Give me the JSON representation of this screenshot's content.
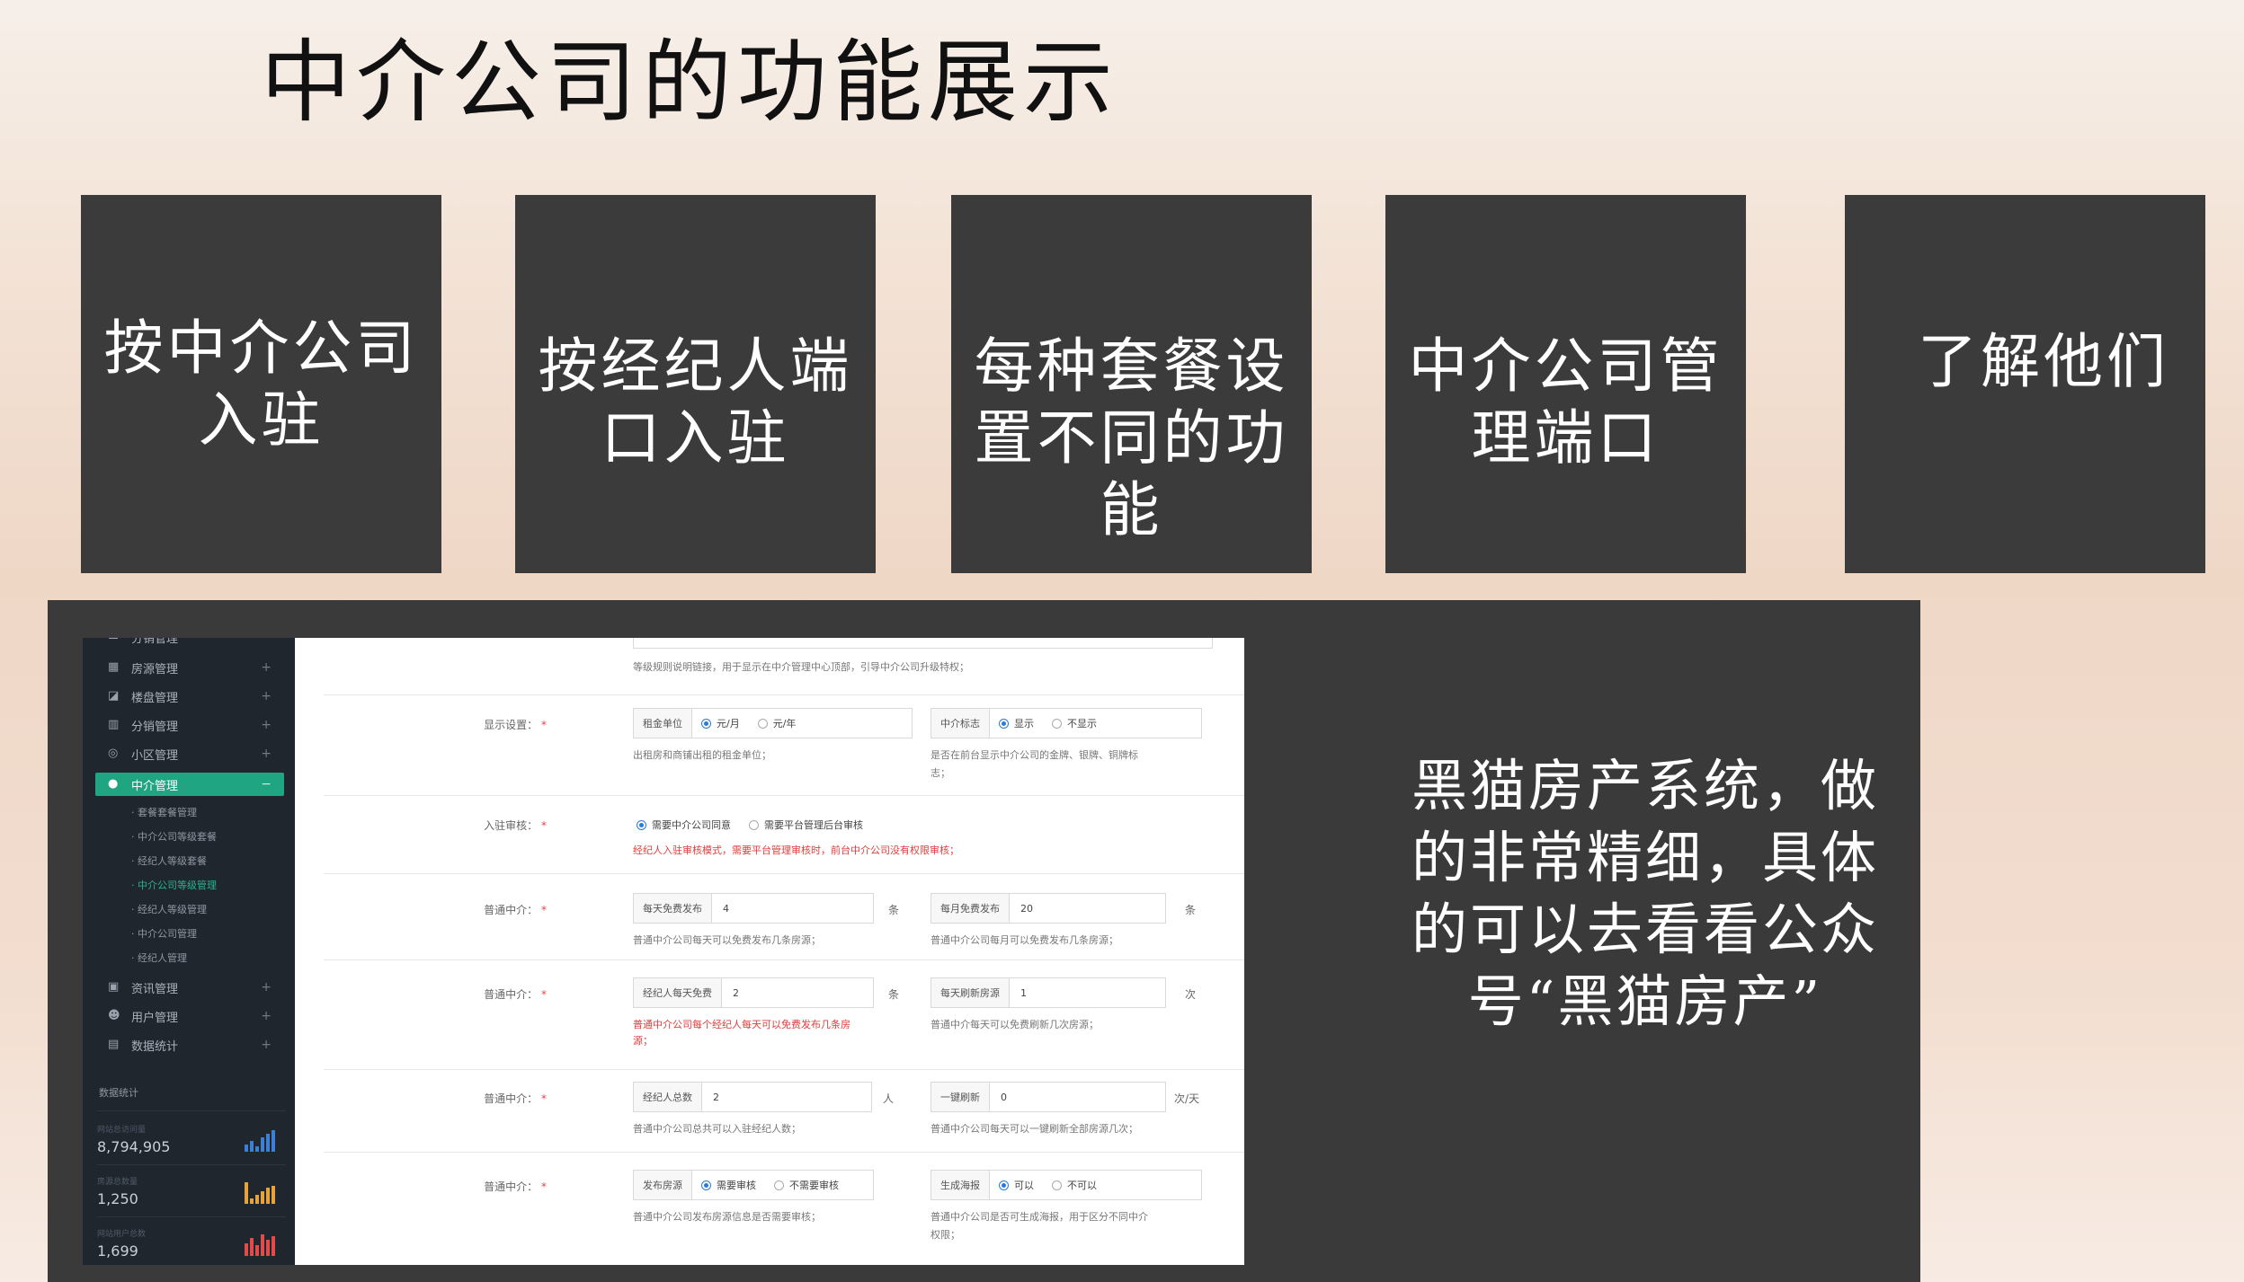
{
  "slide": {
    "title": "中介公司的功能展示",
    "cards": [
      {
        "lines": [
          "按中介公司",
          "入驻"
        ]
      },
      {
        "lines": [
          "按经纪人端",
          "口入驻"
        ]
      },
      {
        "lines": [
          "每种套餐设",
          "置不同的功",
          "能"
        ]
      },
      {
        "lines": [
          "中介公司管",
          "理端口"
        ]
      },
      {
        "lines": [
          "了解他们"
        ]
      }
    ],
    "note": "黑猫房产系统，做的非常精细，具体的可以去看看公众号“黑猫房产”"
  },
  "sidebar": {
    "top_cut": "分销管理",
    "items": [
      {
        "label": "房源管理",
        "icon": "grid-icon"
      },
      {
        "label": "楼盘管理",
        "icon": "building-icon"
      },
      {
        "label": "分销管理",
        "icon": "bank-icon"
      },
      {
        "label": "小区管理",
        "icon": "target-icon"
      },
      {
        "label": "中介管理",
        "icon": "globe-icon",
        "active": true
      }
    ],
    "subitems": [
      {
        "label": "· 套餐套餐管理"
      },
      {
        "label": "· 中介公司等级套餐"
      },
      {
        "label": "· 经纪人等级套餐"
      },
      {
        "label": "· 中介公司等级管理",
        "active": true
      },
      {
        "label": "· 经纪人等级管理"
      },
      {
        "label": "· 中介公司管理"
      },
      {
        "label": "· 经纪人管理"
      }
    ],
    "lower_items": [
      {
        "label": "资讯管理",
        "icon": "image-icon"
      },
      {
        "label": "用户管理",
        "icon": "user-icon"
      },
      {
        "label": "数据统计",
        "icon": "chart-icon"
      }
    ],
    "stats_heading": "数据统计",
    "stats": [
      {
        "label": "网站总访问量",
        "value": "8,794,905",
        "color": "#3e7fd6"
      },
      {
        "label": "房源总数量",
        "value": "1,250",
        "color": "#e6a33a"
      },
      {
        "label": "网站用户总数",
        "value": "1,699",
        "color": "#e34a4a"
      }
    ]
  },
  "form": {
    "intro_help": "等级规则说明链接，用于显示在中介管理中心顶部，引导中介公司升级特权；",
    "rows": {
      "display": {
        "label": "显示设置：",
        "unit_prefix": "租金单位",
        "opt1": "元/月",
        "opt2": "元/年",
        "help1": "出租房和商铺出租的租金单位；",
        "flag_prefix": "中介标志",
        "flag_opt1": "显示",
        "flag_opt2": "不显示",
        "help2a": "是否在前台显示中介公司的金牌、银牌、铜牌标",
        "help2b": "志；"
      },
      "audit": {
        "label": "入驻审核：",
        "opt1": "需要中介公司同意",
        "opt2": "需要平台管理后台审核",
        "help": "经纪人入驻审核模式，需要平台管理审核时，前台中介公司没有权限审核；"
      },
      "post": {
        "label": "普通中介：",
        "a_prefix": "每天免费发布",
        "a_val": "4",
        "a_unit": "条",
        "a_help": "普通中介公司每天可以免费发布几条房源；",
        "b_prefix": "每月免费发布",
        "b_val": "20",
        "b_unit": "条",
        "b_help": "普通中介公司每月可以免费发布几条房源；"
      },
      "agent": {
        "label": "普通中介：",
        "a_prefix": "经纪人每天免费",
        "a_val": "2",
        "a_unit": "条",
        "a_help1": "普通中介公司每个经纪人每天可以免费发布几条房",
        "a_help2": "源；",
        "b_prefix": "每天刷新房源",
        "b_val": "1",
        "b_unit": "次",
        "b_help": "普通中介每天可以免费刷新几次房源；"
      },
      "total": {
        "label": "普通中介：",
        "a_prefix": "经纪人总数",
        "a_val": "2",
        "a_unit": "人",
        "a_help": "普通中介公司总共可以入驻经纪人数；",
        "b_prefix": "一键刷新",
        "b_val": "0",
        "b_unit": "次/天",
        "b_help": "普通中介公司每天可以一键刷新全部房源几次；"
      },
      "publish": {
        "label": "普通中介：",
        "a_prefix": "发布房源",
        "a_opt1": "需要审核",
        "a_opt2": "不需要审核",
        "a_help": "普通中介公司发布房源信息是否需要审核；",
        "b_prefix": "生成海报",
        "b_opt1": "可以",
        "b_opt2": "不可以",
        "b_help1": "普通中介公司是否可生成海报，用于区分不同中介",
        "b_help2": "权限；"
      }
    }
  }
}
